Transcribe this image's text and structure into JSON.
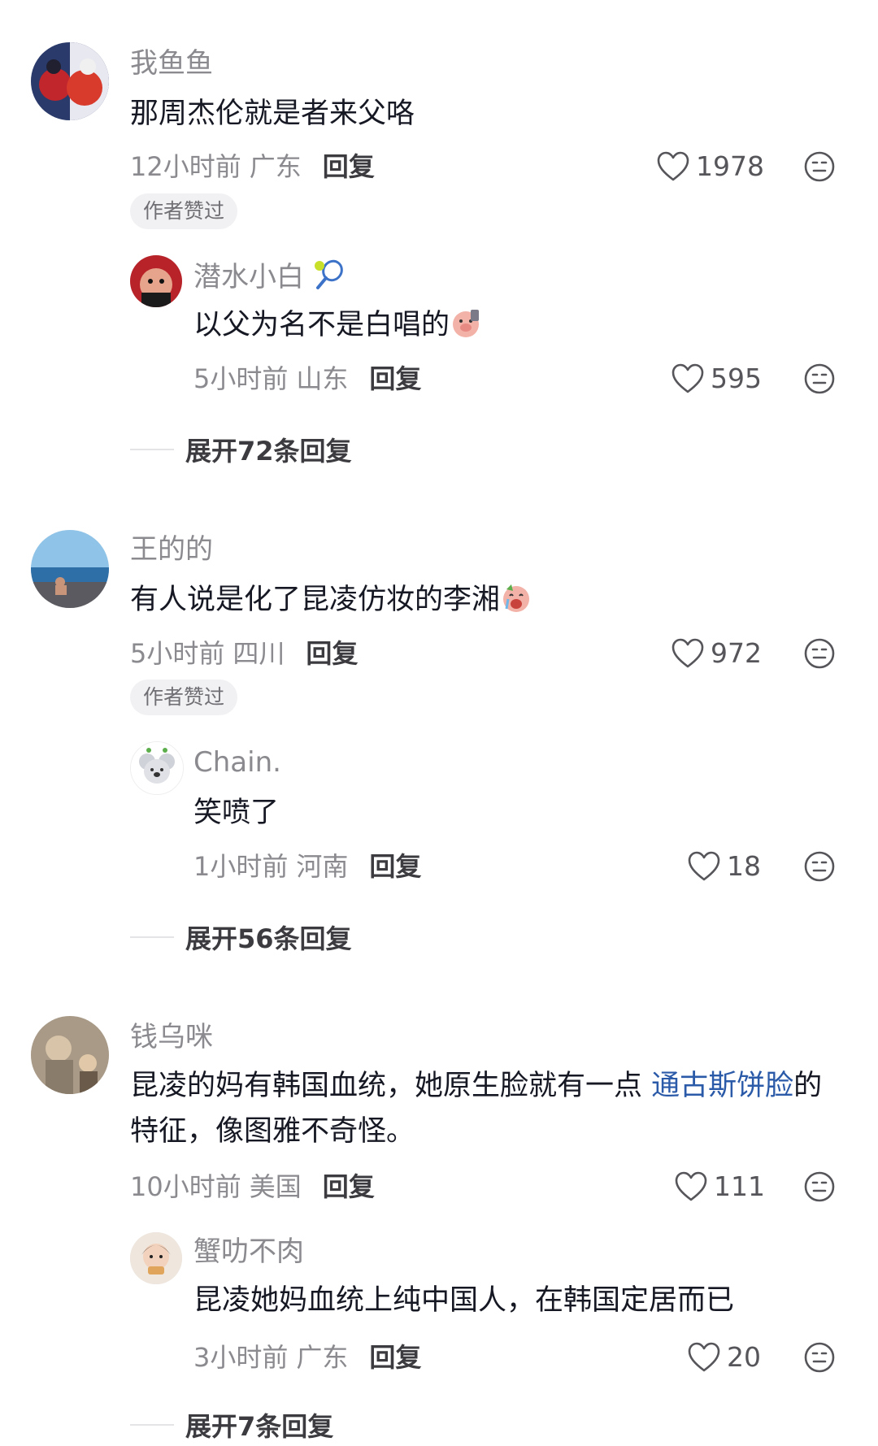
{
  "threads": [
    {
      "username": "我鱼鱼",
      "text": "那周杰伦就是者来父咯",
      "time": "12小时前",
      "region": "广东",
      "reply_label": "回复",
      "likes": "1978",
      "badge": "作者赞过",
      "reply": {
        "username": "潜水小白",
        "text": "以父为名不是白唱的",
        "time": "5小时前",
        "region": "山东",
        "reply_label": "回复",
        "likes": "595"
      },
      "expand_label": "展开72条回复"
    },
    {
      "username": "王的的",
      "text": "有人说是化了昆凌仿妆的李湘",
      "time": "5小时前",
      "region": "四川",
      "reply_label": "回复",
      "likes": "972",
      "badge": "作者赞过",
      "reply": {
        "username": "Chain.",
        "text": "笑喷了",
        "time": "1小时前",
        "region": "河南",
        "reply_label": "回复",
        "likes": "18"
      },
      "expand_label": "展开56条回复"
    },
    {
      "username": "钱乌咪",
      "text_part1": "昆凌的妈有韩国血统，她原生脸就有一点",
      "text_link": "通古斯饼脸",
      "text_part2": "的特征，像图雅不奇怪。",
      "time": "10小时前",
      "region": "美国",
      "reply_label": "回复",
      "likes": "111",
      "reply": {
        "username": "蟹叻不肉",
        "text": "昆凌她妈血统上纯中国人，在韩国定居而已",
        "time": "3小时前",
        "region": "广东",
        "reply_label": "回复",
        "likes": "20"
      },
      "expand_label": "展开7条回复"
    }
  ],
  "colors": {
    "link": "#2b5aa8",
    "meta": "#8a8a8f",
    "text": "#161823"
  },
  "icons": {
    "like": "heart-outline-icon",
    "emoji": "expressionless-face-icon"
  }
}
